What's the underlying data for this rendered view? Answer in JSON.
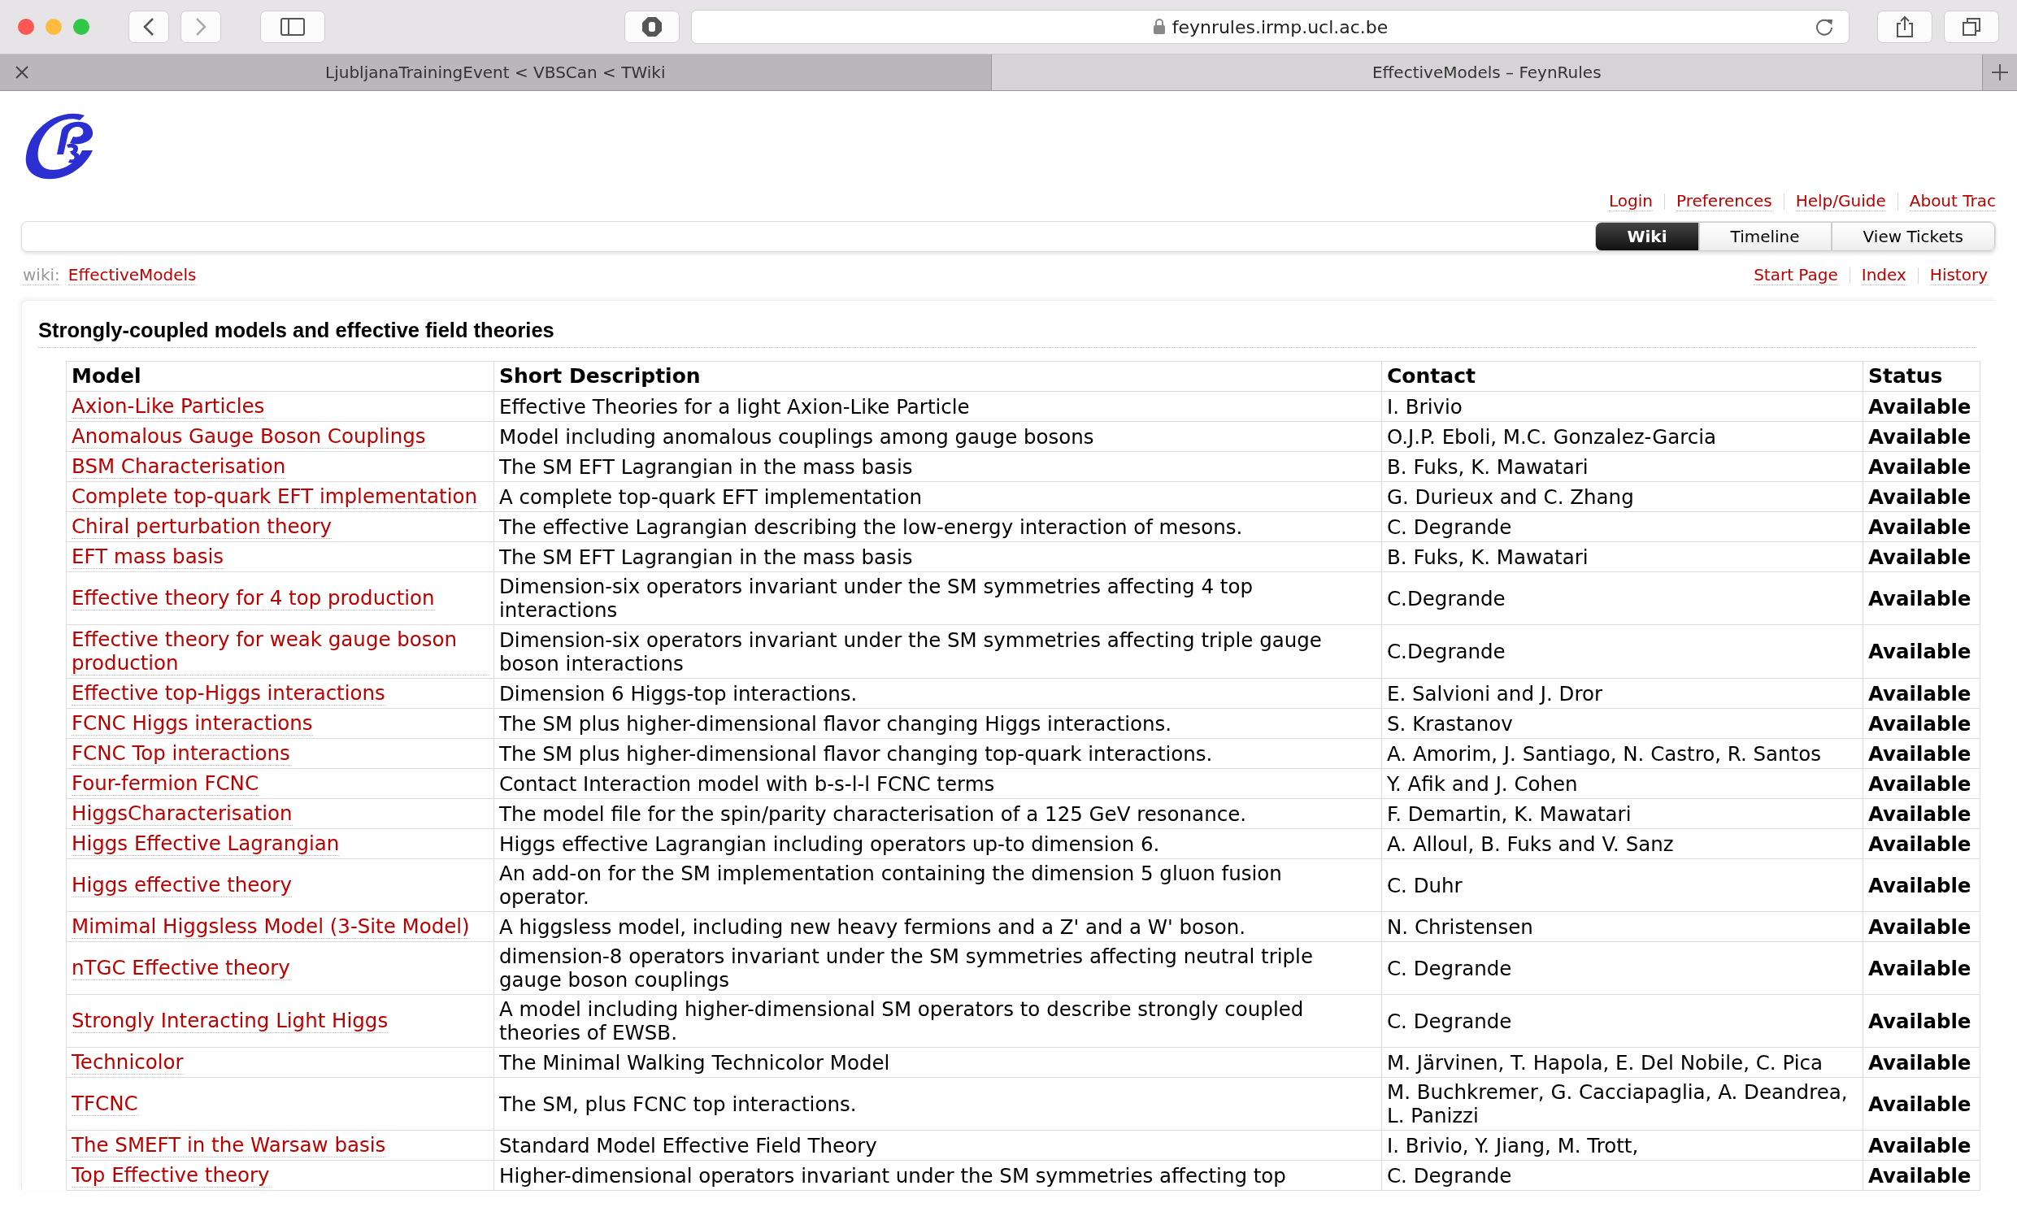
{
  "browser": {
    "url": "feynrules.irmp.ucl.ac.be",
    "tabs": [
      {
        "title": "LjubljanaTrainingEvent < VBSCan < TWiki",
        "selected": false
      },
      {
        "title": "EffectiveModels – FeynRules",
        "selected": true
      }
    ]
  },
  "meta_nav": [
    "Login",
    "Preferences",
    "Help/Guide",
    "About Trac"
  ],
  "main_nav": [
    {
      "label": "Wiki",
      "selected": true
    },
    {
      "label": "Timeline",
      "selected": false
    },
    {
      "label": "View Tickets",
      "selected": false
    }
  ],
  "breadcrumb": {
    "prefix": "wiki:",
    "page": "EffectiveModels"
  },
  "context_nav": [
    "Start Page",
    "Index",
    "History"
  ],
  "heading": "Strongly-coupled models and effective field theories",
  "table": {
    "columns": [
      "Model",
      "Short Description",
      "Contact",
      "Status"
    ],
    "rows": [
      {
        "model": "Axion-Like Particles",
        "description": "Effective Theories for a light Axion-Like Particle",
        "contact": "I. Brivio",
        "status": "Available"
      },
      {
        "model": "Anomalous Gauge Boson Couplings",
        "description": "Model including anomalous couplings among gauge bosons",
        "contact": "O.J.P. Eboli, M.C. Gonzalez-Garcia",
        "status": "Available"
      },
      {
        "model": "BSM Characterisation",
        "description": "The SM EFT Lagrangian in the mass basis",
        "contact": "B. Fuks, K. Mawatari",
        "status": "Available"
      },
      {
        "model": "Complete top-quark EFT implementation",
        "description": "A complete top-quark EFT implementation",
        "contact": "G. Durieux and C. Zhang",
        "status": "Available"
      },
      {
        "model": "Chiral perturbation theory",
        "description": "The effective Lagrangian describing the low-energy interaction of mesons.",
        "contact": "C. Degrande",
        "status": "Available"
      },
      {
        "model": "EFT mass basis",
        "description": "The SM EFT Lagrangian in the mass basis",
        "contact": "B. Fuks, K. Mawatari",
        "status": "Available"
      },
      {
        "model": "Effective theory for 4 top production",
        "description": "Dimension-six operators invariant under the SM symmetries affecting 4 top interactions",
        "contact": "C.Degrande",
        "status": "Available"
      },
      {
        "model": "Effective theory for weak gauge boson production",
        "description": "Dimension-six operators invariant under the SM symmetries affecting triple gauge boson interactions",
        "contact": "C.Degrande",
        "status": "Available"
      },
      {
        "model": "Effective top-Higgs interactions",
        "description": "Dimension 6 Higgs-top interactions.",
        "contact": "E. Salvioni and J. Dror",
        "status": "Available"
      },
      {
        "model": "FCNC Higgs interactions",
        "description": "The SM plus higher-dimensional flavor changing Higgs interactions.",
        "contact": "S. Krastanov",
        "status": "Available"
      },
      {
        "model": "FCNC Top interactions",
        "description": "The SM plus higher-dimensional flavor changing top-quark interactions.",
        "contact": "A. Amorim, J. Santiago, N. Castro, R. Santos",
        "status": "Available"
      },
      {
        "model": "Four-fermion FCNC",
        "description": "Contact Interaction model with b-s-l-l FCNC terms",
        "contact": "Y. Afik and J. Cohen",
        "status": "Available"
      },
      {
        "model": "HiggsCharacterisation",
        "description": "The model file for the spin/parity characterisation of a 125 GeV resonance.",
        "contact": "F. Demartin, K. Mawatari",
        "status": "Available"
      },
      {
        "model": "Higgs Effective Lagrangian",
        "description": "Higgs effective Lagrangian including operators up-to dimension 6.",
        "contact": "A. Alloul, B. Fuks and V. Sanz",
        "status": "Available"
      },
      {
        "model": "Higgs effective theory",
        "description": "An add-on for the SM implementation containing the dimension 5 gluon fusion operator.",
        "contact": "C. Duhr",
        "status": "Available"
      },
      {
        "model": "Mimimal Higgsless Model (3-Site Model)",
        "description": "A higgsless model, including new heavy fermions and a Z' and a W' boson.",
        "contact": "N. Christensen",
        "status": "Available"
      },
      {
        "model": "nTGC Effective theory",
        "description": "dimension-8 operators invariant under the SM symmetries affecting neutral triple gauge boson couplings",
        "contact": "C. Degrande",
        "status": "Available"
      },
      {
        "model": "Strongly Interacting Light Higgs",
        "description": "A model including higher-dimensional SM operators to describe strongly coupled theories of EWSB.",
        "contact": "C. Degrande",
        "status": "Available"
      },
      {
        "model": "Technicolor",
        "description": "The Minimal Walking Technicolor Model",
        "contact": "M. Järvinen, T. Hapola, E. Del Nobile, C. Pica",
        "status": "Available"
      },
      {
        "model": "TFCNC",
        "description": "The SM, plus FCNC top interactions.",
        "contact": "M. Buchkremer, G. Cacciapaglia, A. Deandrea, L. Panizzi",
        "status": "Available"
      },
      {
        "model": "The SMEFT in the Warsaw basis",
        "description": "Standard Model Effective Field Theory",
        "contact": "I. Brivio, Y. Jiang, M. Trott,",
        "status": "Available"
      },
      {
        "model": "Top Effective theory",
        "description": "Higher-dimensional operators invariant under the SM symmetries affecting top",
        "contact": "C. Degrande",
        "status": "Available"
      }
    ]
  }
}
